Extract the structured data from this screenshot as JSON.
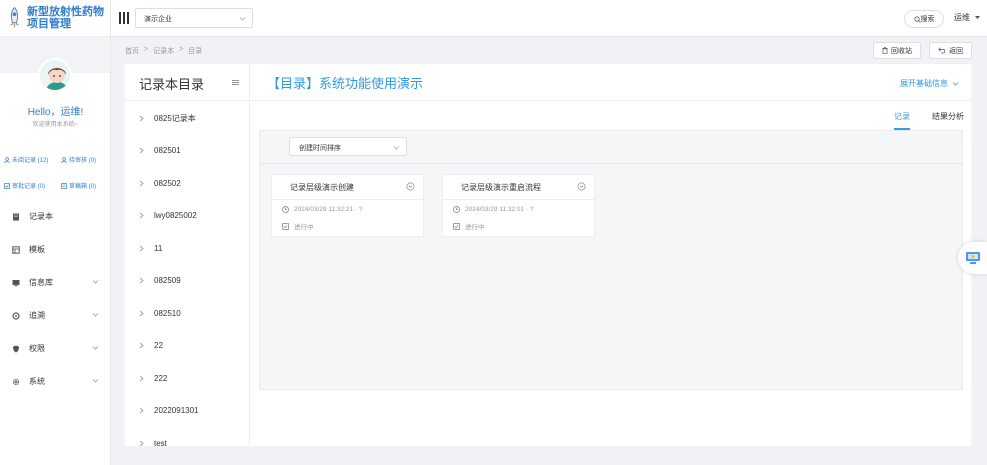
{
  "app": {
    "title": "新型放射性药物项目管理"
  },
  "sidebar": {
    "hello": "Hello，运维!",
    "welcome": "欢迎使用本系统~",
    "stats": {
      "recent": "未阅记录 (12)",
      "pending": "待审核 (0)",
      "approved": "审批记录 (0)",
      "drafts": "草稿箱 (0)"
    },
    "nav": [
      {
        "label": "记录本"
      },
      {
        "label": "模板"
      },
      {
        "label": "信息库"
      },
      {
        "label": "追溯"
      },
      {
        "label": "权限"
      },
      {
        "label": "系统"
      }
    ]
  },
  "topbar": {
    "company": "演示企业",
    "search_label": "搜索",
    "user": "运维"
  },
  "breadcrumb": {
    "home": "首页",
    "sep": ">",
    "notebook": "记录本",
    "current": "目录"
  },
  "actions": {
    "recycle": "回收站",
    "back": "返回"
  },
  "directory": {
    "title": "记录本目录",
    "items": [
      "0825记录本",
      "082501",
      "082502",
      "lwy0825002",
      "11",
      "082509",
      "082510",
      "22",
      "222",
      "2022091301",
      "test"
    ]
  },
  "content": {
    "title": "【目录】系统功能使用演示",
    "basic_info": "展开基础信息",
    "tabs": {
      "records": "记录",
      "analysis": "结果分析"
    },
    "sort": "创建时间排序",
    "cards": [
      {
        "name": "记录层级演示创建",
        "time": "2024/03/29 11:32:21 · ?",
        "status": "进行中"
      },
      {
        "name": "记录层级演示重启流程",
        "time": "2024/03/29 11:32:01 · ?",
        "status": "进行中"
      }
    ]
  },
  "colors": {
    "accent": "#2f9be0",
    "brand": "#2f7fd1"
  }
}
